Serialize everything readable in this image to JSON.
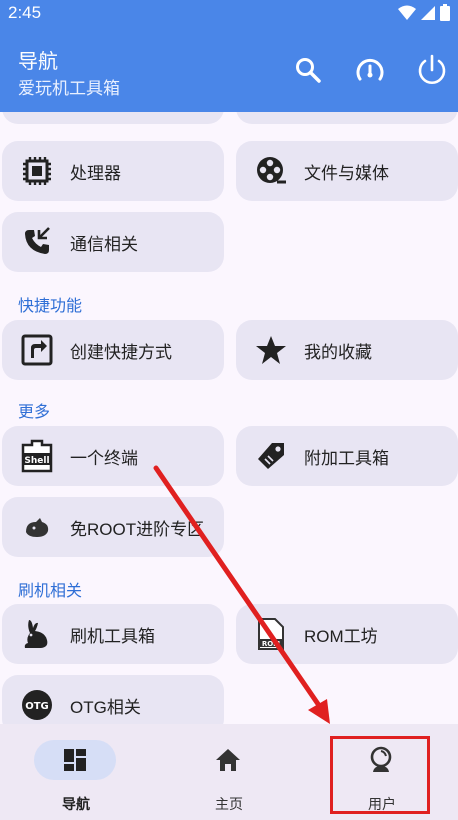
{
  "status_bar": {
    "time": "2:45"
  },
  "app_bar": {
    "title": "导航",
    "subtitle": "爱玩机工具箱",
    "actions": [
      "search-icon",
      "speedometer-icon",
      "power-icon"
    ]
  },
  "sections": [
    {
      "title": "",
      "items": [
        {
          "label": "处理器",
          "icon": "cpu-icon"
        },
        {
          "label": "文件与媒体",
          "icon": "film-reel-icon"
        },
        {
          "label": "通信相关",
          "icon": "phone-call-icon"
        }
      ]
    },
    {
      "title": "快捷功能",
      "items": [
        {
          "label": "创建快捷方式",
          "icon": "shortcut-icon"
        },
        {
          "label": "我的收藏",
          "icon": "star-icon"
        }
      ]
    },
    {
      "title": "更多",
      "items": [
        {
          "label": "一个终端",
          "icon": "shell-icon"
        },
        {
          "label": "附加工具箱",
          "icon": "tag-icon"
        },
        {
          "label": "免ROOT进阶专区",
          "icon": "fox-icon"
        }
      ]
    },
    {
      "title": "刷机相关",
      "items": [
        {
          "label": "刷机工具箱",
          "icon": "rabbit-icon"
        },
        {
          "label": "ROM工坊",
          "icon": "rom-file-icon"
        },
        {
          "label": "OTG相关",
          "icon": "otg-icon"
        }
      ]
    }
  ],
  "bottom_nav": {
    "items": [
      {
        "label": "导航",
        "icon": "dashboard-icon",
        "active": true
      },
      {
        "label": "主页",
        "icon": "home-icon",
        "active": false
      },
      {
        "label": "用户",
        "icon": "user-icon",
        "active": false
      }
    ]
  },
  "colors": {
    "app_bar": "#4a86e8",
    "section_title": "#2f6fd6",
    "card": "#e8e5f3",
    "annotation": "#e02020"
  }
}
